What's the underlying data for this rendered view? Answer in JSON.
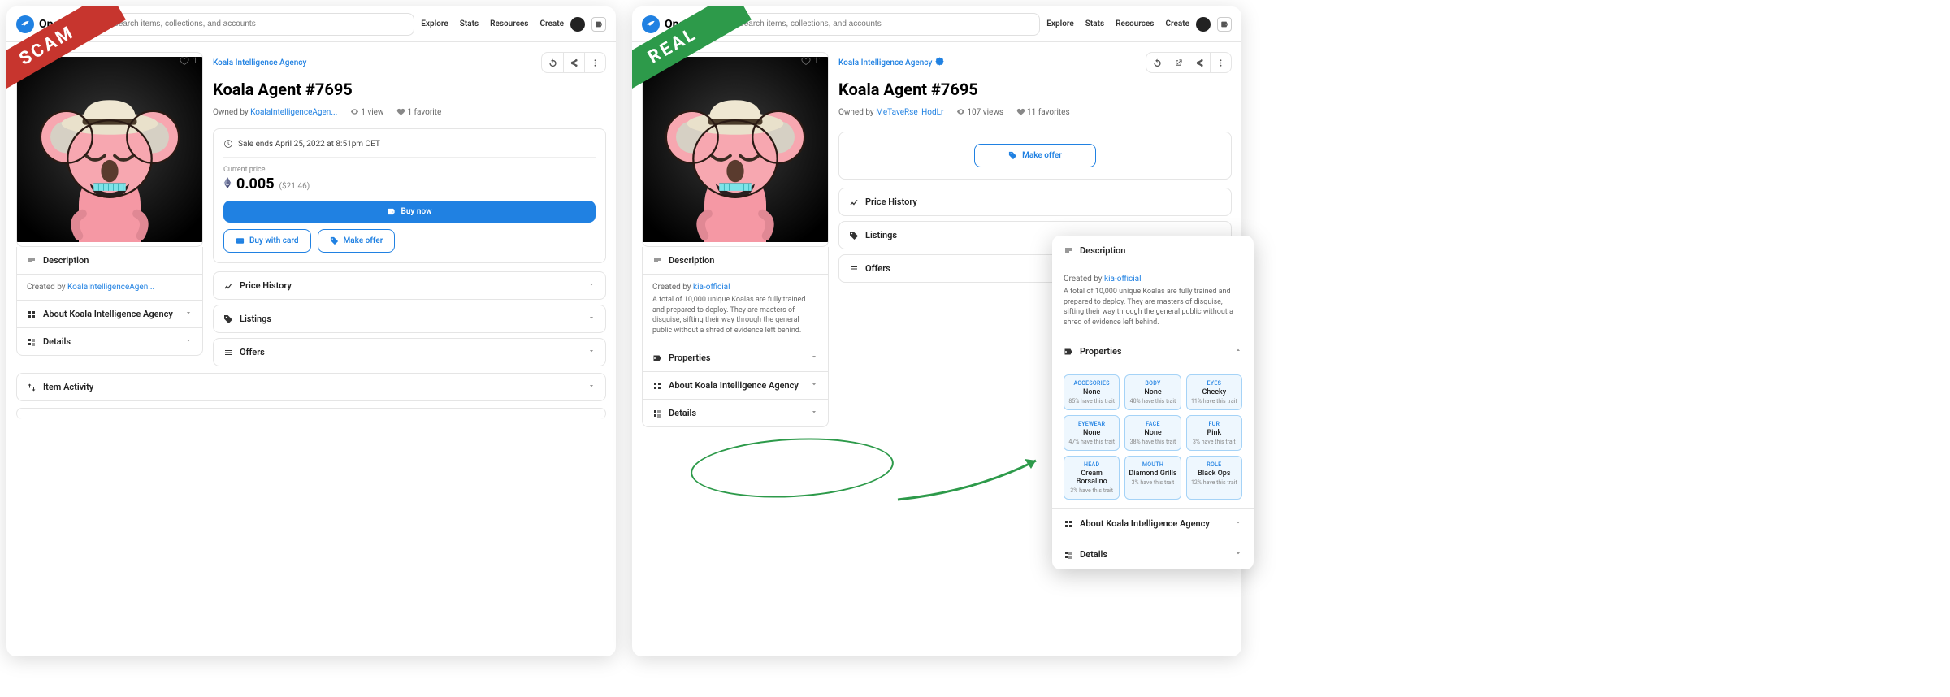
{
  "brand": "OpenSea",
  "search_placeholder": "Search items, collections, and accounts",
  "nav": {
    "explore": "Explore",
    "stats": "Stats",
    "resources": "Resources",
    "create": "Create"
  },
  "ribbon": {
    "scam": "SCAM",
    "real": "REAL"
  },
  "scam": {
    "collection": "Koala Intelligence Agency",
    "title": "Koala Agent #7695",
    "owned_by_label": "Owned by",
    "owner": "KoalaIntelligenceAgen...",
    "views": "1 view",
    "favorites": "1 favorite",
    "fav_count": "1",
    "sale_ends": "Sale ends April 25, 2022 at 8:51pm CET",
    "current_price_label": "Current price",
    "price": "0.005",
    "price_usd": "($21.46)",
    "btn_buy": "Buy now",
    "btn_card": "Buy with card",
    "btn_offer": "Make offer",
    "sec_price_history": "Price History",
    "sec_listings": "Listings",
    "sec_offers": "Offers",
    "sec_description": "Description",
    "created_by_label": "Created by",
    "created_by": "KoalaIntelligenceAgen...",
    "sec_about": "About Koala Intelligence Agency",
    "sec_details": "Details",
    "sec_activity": "Item Activity"
  },
  "real": {
    "collection": "Koala Intelligence Agency",
    "verified": true,
    "title": "Koala Agent #7695",
    "owned_by_label": "Owned by",
    "owner": "MeTaveRse_HodLr",
    "views": "107 views",
    "favorites": "11 favorites",
    "fav_count": "11",
    "btn_offer": "Make offer",
    "sec_price_history": "Price History",
    "sec_listings": "Listings",
    "sec_offers": "Offers",
    "sec_description": "Description",
    "created_by_label": "Created by",
    "created_by": "kia-official",
    "description_text": "A total of 10,000 unique Koalas are fully trained and prepared to deploy. They are masters of disguise, sifting their way through the general public without a shred of evidence left behind.",
    "sec_properties": "Properties",
    "sec_about": "About Koala Intelligence Agency",
    "sec_details": "Details"
  },
  "popup": {
    "sec_description": "Description",
    "created_by_label": "Created by",
    "created_by": "kia-official",
    "description_text": "A total of 10,000 unique Koalas are fully trained and prepared to deploy. They are masters of disguise, sifting their way through the general public without a shred of evidence left behind.",
    "sec_properties": "Properties",
    "properties": [
      {
        "type": "ACCESORIES",
        "value": "None",
        "rarity": "85% have this trait"
      },
      {
        "type": "BODY",
        "value": "None",
        "rarity": "40% have this trait"
      },
      {
        "type": "EYES",
        "value": "Cheeky",
        "rarity": "11% have this trait"
      },
      {
        "type": "EYEWEAR",
        "value": "None",
        "rarity": "47% have this trait"
      },
      {
        "type": "FACE",
        "value": "None",
        "rarity": "38% have this trait"
      },
      {
        "type": "FUR",
        "value": "Pink",
        "rarity": "3% have this trait"
      },
      {
        "type": "HEAD",
        "value": "Cream Borsalino",
        "rarity": "3% have this trait"
      },
      {
        "type": "MOUTH",
        "value": "Diamond Grills",
        "rarity": "3% have this trait"
      },
      {
        "type": "ROLE",
        "value": "Black Ops",
        "rarity": "12% have this trait"
      }
    ],
    "sec_about": "About Koala Intelligence Agency",
    "sec_details": "Details"
  }
}
